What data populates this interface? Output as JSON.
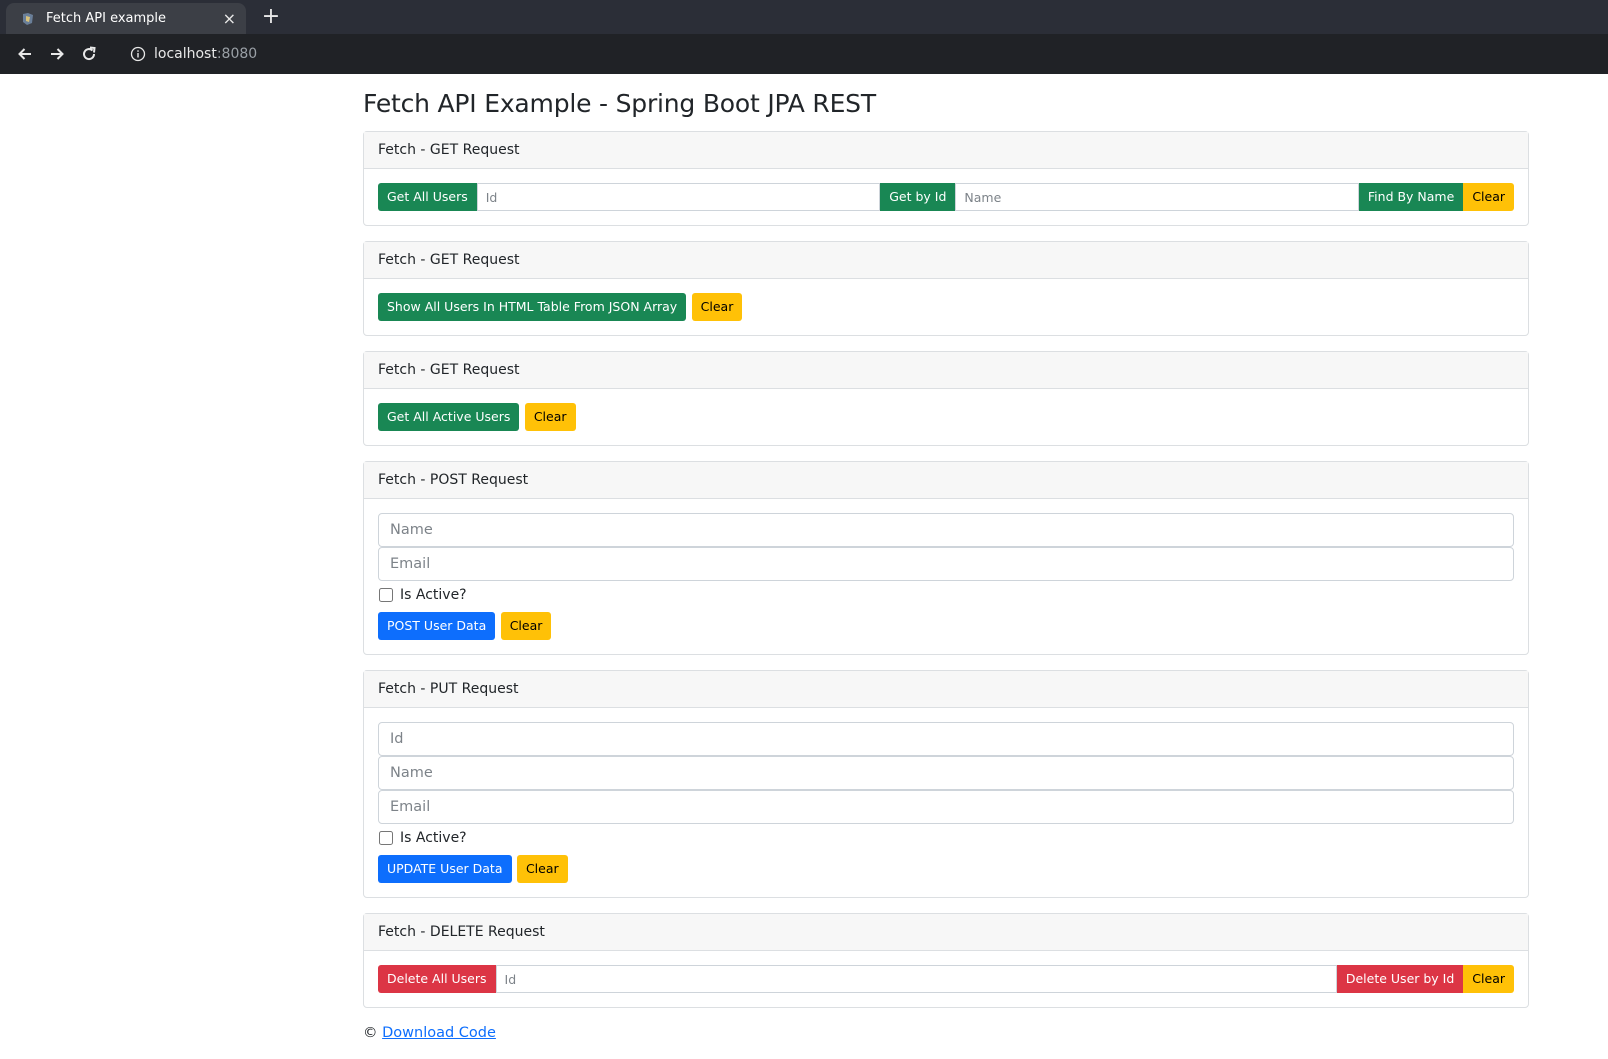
{
  "browser": {
    "tab_title": "Fetch API example",
    "tab_close": "×",
    "new_tab": "+",
    "address_host": "localhost",
    "address_port": ":8080"
  },
  "page": {
    "title": "Fetch API Example - Spring Boot JPA REST"
  },
  "get_card_1": {
    "header": "Fetch - GET Request",
    "get_all_label": "Get All Users",
    "id_placeholder": "Id",
    "get_by_id_label": "Get by Id",
    "name_placeholder": "Name",
    "find_by_name_label": "Find By Name",
    "clear_label": "Clear"
  },
  "get_card_2": {
    "header": "Fetch - GET Request",
    "show_table_label": "Show All Users In HTML Table From JSON Array",
    "clear_label": "Clear"
  },
  "get_card_3": {
    "header": "Fetch - GET Request",
    "get_active_label": "Get All Active Users",
    "clear_label": "Clear"
  },
  "post_card": {
    "header": "Fetch - POST Request",
    "name_placeholder": "Name",
    "email_placeholder": "Email",
    "active_label": "Is Active?",
    "post_label": "POST User Data",
    "clear_label": "Clear"
  },
  "put_card": {
    "header": "Fetch - PUT Request",
    "id_placeholder": "Id",
    "name_placeholder": "Name",
    "email_placeholder": "Email",
    "active_label": "Is Active?",
    "update_label": "UPDATE User Data",
    "clear_label": "Clear"
  },
  "delete_card": {
    "header": "Fetch - DELETE Request",
    "delete_all_label": "Delete All Users",
    "id_placeholder": "Id",
    "delete_by_id_label": "Delete User by Id",
    "clear_label": "Clear"
  },
  "footer": {
    "copyright": "©",
    "link_text": "Download Code"
  },
  "colors": {
    "success": "#198754",
    "warning": "#ffc107",
    "primary": "#0d6efd",
    "danger": "#dc3545"
  }
}
